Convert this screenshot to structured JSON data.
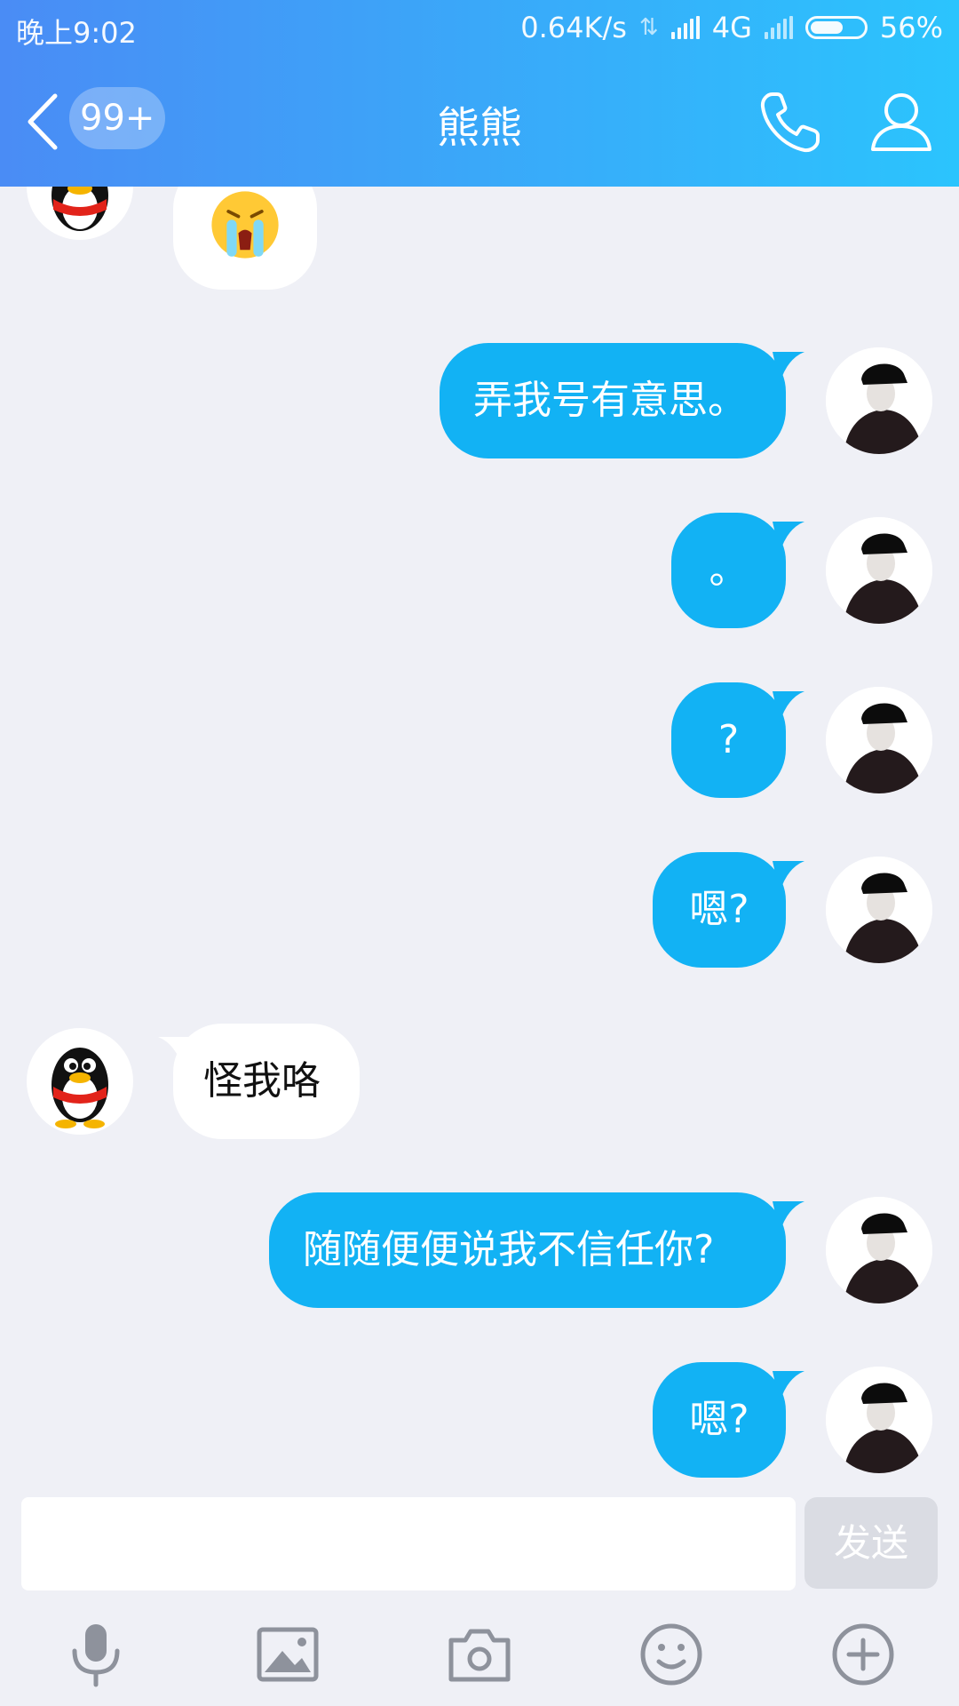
{
  "status_bar": {
    "time": "晚上9:02",
    "network_speed": "0.64K/s",
    "network_type": "4G",
    "battery": "56%"
  },
  "header": {
    "unread_count": "99+",
    "title": "熊熊"
  },
  "messages": [
    {
      "from": "contact",
      "type": "emoji",
      "icon": "crying-face-emoji"
    },
    {
      "from": "me",
      "text": "弄我号有意思。"
    },
    {
      "from": "me",
      "text": "。"
    },
    {
      "from": "me",
      "text": "?"
    },
    {
      "from": "me",
      "text": "嗯?"
    },
    {
      "from": "contact",
      "text": "怪我咯"
    },
    {
      "from": "me",
      "text": "随随便便说我不信任你?"
    },
    {
      "from": "me",
      "text": "嗯?"
    }
  ],
  "input": {
    "placeholder": "",
    "send_label": "发送"
  },
  "toolbar": [
    "microphone-icon",
    "image-icon",
    "camera-icon",
    "emoji-icon",
    "plus-icon"
  ],
  "colors": {
    "header_gradient_start": "#4A8CF5",
    "header_gradient_end": "#2BC4FD",
    "outgoing_bubble": "#12B2F4",
    "incoming_bubble": "#FFFFFF",
    "background": "#EFF0F6"
  }
}
